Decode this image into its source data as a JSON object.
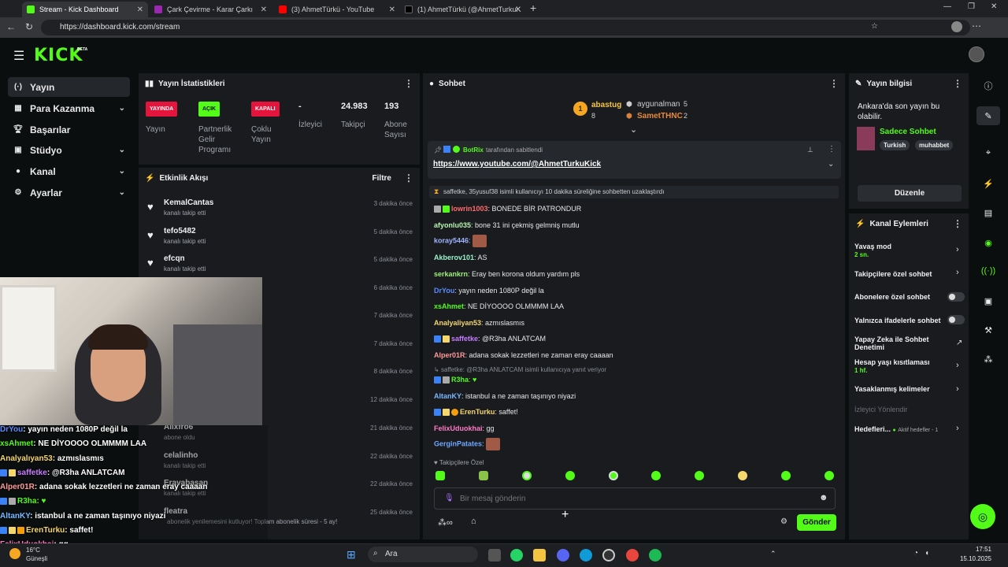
{
  "browser": {
    "tabs": [
      {
        "title": "Stream - Kick Dashboard",
        "color": "#53fc18"
      },
      {
        "title": "Çark Çevirme - Karar Çarkı",
        "color": "#9c27b0"
      },
      {
        "title": "(3) AhmetTürkü - YouTube",
        "color": "#ff0000"
      },
      {
        "title": "(1) AhmetTürkü (@AhmetTurkuK",
        "color": "#000000"
      }
    ],
    "url": "https://dashboard.kick.com/stream"
  },
  "brand": {
    "logo": "KICK",
    "badge": "BETA"
  },
  "sidebar": {
    "items": [
      {
        "label": "Yayın",
        "icon": "broadcast-icon"
      },
      {
        "label": "Para Kazanma",
        "icon": "money-icon"
      },
      {
        "label": "Başarılar",
        "icon": "trophy-icon"
      },
      {
        "label": "Stüdyo",
        "icon": "studio-icon"
      },
      {
        "label": "Kanal",
        "icon": "user-icon"
      },
      {
        "label": "Ayarlar",
        "icon": "gear-icon"
      }
    ]
  },
  "stats": {
    "title": "Yayın İstatistikleri",
    "items": [
      {
        "value": "YAYINDA",
        "label": "Yayın",
        "color": "#e5143c"
      },
      {
        "value": "AÇIK",
        "label": "Partnerlik Gelir Programı",
        "color": "#53fc18"
      },
      {
        "value": "KAPALI",
        "label": "Çoklu Yayın",
        "color": "#e5143c"
      },
      {
        "value": "-",
        "label": "İzleyici"
      },
      {
        "value": "24.983",
        "label": "Takipçi"
      },
      {
        "value": "193",
        "label": "Abone Sayısı"
      }
    ]
  },
  "activity": {
    "title": "Etkinlik Akışı",
    "filter": "Filtre",
    "items": [
      {
        "name": "KemalCantas",
        "sub": "kanalı takip etti",
        "time": "3 dakika önce"
      },
      {
        "name": "tefo5482",
        "sub": "kanalı takip etti",
        "time": "5 dakika önce"
      },
      {
        "name": "efcqn",
        "sub": "kanalı takip etti",
        "time": "5 dakika önce"
      },
      {
        "name": "",
        "sub": "",
        "time": "6 dakika önce"
      },
      {
        "name": "",
        "sub": "",
        "time": "7 dakika önce"
      },
      {
        "name": "",
        "sub": "",
        "time": "7 dakika önce"
      },
      {
        "name": "",
        "sub": "",
        "time": "8 dakika önce"
      },
      {
        "name": "",
        "sub": "",
        "time": "12 dakika önce"
      },
      {
        "name": "Allxfro6",
        "sub": "abone oldu",
        "time": "21 dakika önce"
      },
      {
        "name": "celalinho",
        "sub": "kanalı takip etti",
        "time": "22 dakika önce"
      },
      {
        "name": "Eravabasan",
        "sub": "kanalı takip etti",
        "time": "22 dakika önce"
      },
      {
        "name": "fleatra",
        "sub": "abonelik yenilemesini kutluyor! Toplam abonelik süresi - 5 ay!",
        "time": "25 dakika önce"
      }
    ]
  },
  "chat": {
    "title": "Sohbet",
    "leaders": {
      "first": {
        "name": "abastug",
        "count": "8"
      },
      "second": {
        "name": "aygunalman",
        "count": "5"
      },
      "third": {
        "name": "SametTHNC",
        "count": "2"
      }
    },
    "pinned": {
      "by": "BotRix",
      "by_suffix": "tarafından sabitlendi",
      "link": "https://www.youtube.com/@AhmetTurkuKick"
    },
    "system": "saffetke, 35yusuf38 isimli kullanıcıyı 10 dakika süreliğine sohbetten uzaklaştırdı",
    "reply_note": "saffetke: @R3ha ANLATCAM isimli kullanıcıya yanıt veriyor",
    "messages": [
      {
        "user": "lowrin1003",
        "color": "#ff6b6b",
        "text": ": BONEDE BİR PATRONDUR"
      },
      {
        "user": "afyonlu035",
        "color": "#b8f5b0",
        "text": ": bone 31 ini çekmiş gelmniş mutlu"
      },
      {
        "user": "koray5446",
        "color": "#9fb4ff",
        "text": ":"
      },
      {
        "user": "Akberov101",
        "color": "#9af0c8",
        "text": ": AS"
      },
      {
        "user": "serkankrn",
        "color": "#9ef07a",
        "text": ": Eray ben korona oldum yardım pls"
      },
      {
        "user": "DrYou",
        "color": "#5b8cff",
        "text": ": yayın neden 1080P değil la"
      },
      {
        "user": "xsAhmet",
        "color": "#53fc18",
        "text": ": NE DİYOOOO OLMMMM LAA"
      },
      {
        "user": "Analyaliyan53",
        "color": "#f5d76e",
        "text": ": azmıslasmıs"
      },
      {
        "user": "saffetke",
        "color": "#c77dff",
        "text": ": @R3ha ANLATCAM"
      },
      {
        "user": "Alper01R",
        "color": "#ff9a9a",
        "text": ": adana sokak lezzetleri ne zaman eray caaaan"
      },
      {
        "user": "R3ha",
        "color": "#53fc18",
        "text": ": ♥"
      },
      {
        "user": "AltanKY",
        "color": "#7ab8ff",
        "text": ": istanbul a ne zaman taşınıyo niyazi"
      },
      {
        "user": "ErenTurku",
        "color": "#f5d76e",
        "text": ": saffet!"
      },
      {
        "user": "FelixUduokhai",
        "color": "#ff7ac6",
        "text": ": gg"
      },
      {
        "user": "GerginPatates",
        "color": "#6fa8ff",
        "text": ":"
      }
    ],
    "followers_only": "Takipçilere Özel",
    "input_placeholder": "Bir mesaj gönderin",
    "send": "Gönder"
  },
  "streaminfo": {
    "title": "Yayın bilgisi",
    "text": "Ankara'da son yayın bu olabilir.",
    "category": "Sadece Sohbet",
    "tags": [
      "Turkish",
      "muhabbet"
    ],
    "edit": "Düzenle"
  },
  "actions": {
    "title": "Kanal Eylemleri",
    "items": [
      {
        "label": "Yavaş mod",
        "sub": "2 sn.",
        "kind": "chevron"
      },
      {
        "label": "Takipçilere özel sohbet",
        "sub": "",
        "kind": "chevron"
      },
      {
        "label": "Abonelere özel sohbet",
        "sub": "",
        "kind": "toggle"
      },
      {
        "label": "Yalnızca ifadelerle sohbet",
        "sub": "",
        "kind": "toggle"
      },
      {
        "label": "Yapay Zeka ile Sohbet Denetimi",
        "sub": "",
        "kind": "external"
      },
      {
        "label": "Hesap yaşı kısıtlaması",
        "sub": "1 hf.",
        "kind": "chevron"
      },
      {
        "label": "Yasaklanmış kelimeler",
        "sub": "",
        "kind": "chevron"
      },
      {
        "label": "İzleyici Yönlendir",
        "sub": "",
        "kind": "none"
      },
      {
        "label": "Hedefleri...",
        "sub": "Aktif hedefler - 1",
        "kind": "chevron"
      }
    ]
  },
  "overlay": {
    "lines": [
      {
        "user": "DrYou",
        "color": "#5b8cff",
        "text": ": yayın neden 1080P değil la"
      },
      {
        "user": "xsAhmet",
        "color": "#53fc18",
        "text": ": NE DİYOOOO OLMMMM LAA"
      },
      {
        "user": "Analyalıyan53",
        "color": "#f5d76e",
        "text": ": azmıslasmıs"
      },
      {
        "user": "saffetke",
        "color": "#c77dff",
        "text": ": @R3ha ANLATCAM"
      },
      {
        "user": "Alper01R",
        "color": "#ff9a9a",
        "text": ": adana sokak lezzetleri ne zaman eray caaaan"
      },
      {
        "user": "R3ha",
        "color": "#53fc18",
        "text": ": ♥"
      },
      {
        "user": "AltanKY",
        "color": "#7ab8ff",
        "text": ": istanbul a ne zaman taşınıyo niyazi"
      },
      {
        "user": "ErenTurku",
        "color": "#f5d76e",
        "text": ": saffet!"
      },
      {
        "user": "FelixUduokhai",
        "color": "#ff7ac6",
        "text": ": gg"
      }
    ]
  },
  "taskbar": {
    "weather_temp": "16°C",
    "weather_loc": "Güneşli",
    "search": "Ara",
    "time": "17:51",
    "date": "15.10.2025"
  }
}
